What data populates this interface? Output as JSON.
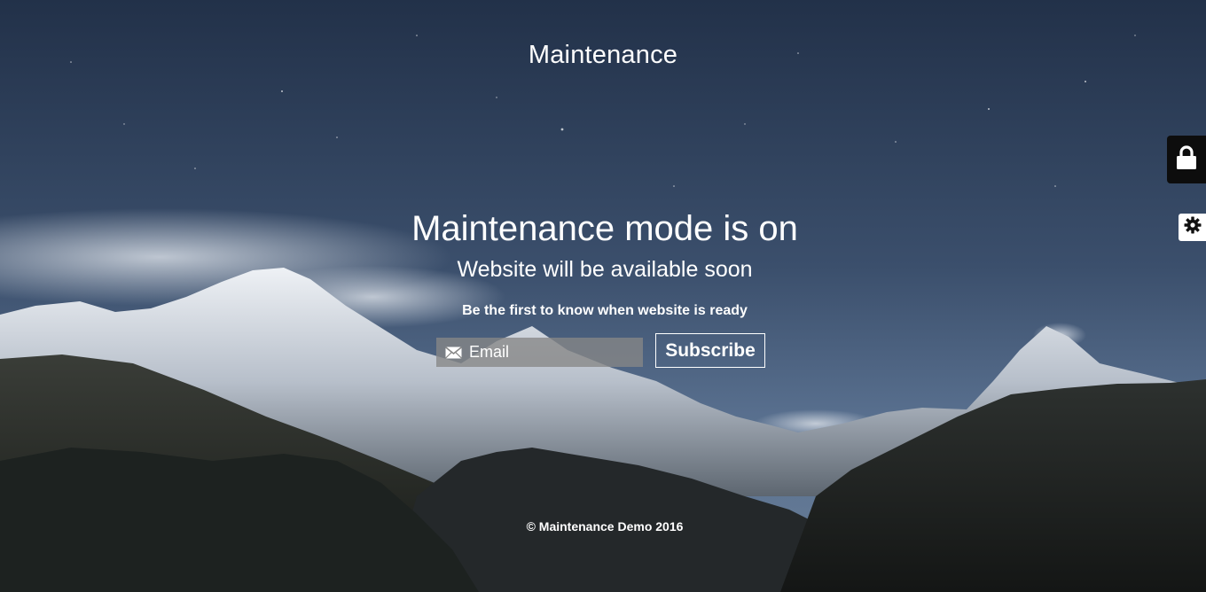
{
  "header": {
    "site_title": "Maintenance"
  },
  "main": {
    "heading": "Maintenance mode is on",
    "subheading": "Website will be available soon",
    "notify_text": "Be the first to know when website is ready"
  },
  "subscribe_form": {
    "email_placeholder": "Email",
    "email_value": "",
    "subscribe_label": "Subscribe"
  },
  "footer": {
    "copyright": "© Maintenance Demo 2016"
  },
  "side_controls": [
    {
      "icon": "lock-icon"
    },
    {
      "icon": "gear-icon"
    }
  ],
  "colors": {
    "sky_top": "#223149",
    "sky_mid": "#4a6080",
    "text": "#ffffff",
    "input_bg": "#878787",
    "lock_tab_bg": "#0d0d0d",
    "gear_tab_bg": "#ffffff"
  }
}
